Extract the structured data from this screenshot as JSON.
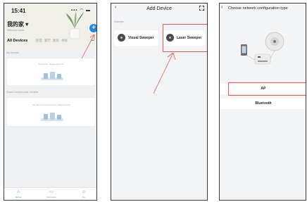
{
  "phone1": {
    "status_time": "15:41",
    "home_title": "我的家 ▾",
    "home_subtitle": "Welcome home",
    "tabs": [
      "All Devices",
      "卧室",
      "客厅",
      "厨房",
      "书房"
    ],
    "more": "•••",
    "my_devices_label": "My Devices",
    "no_devices_text": "No device, please add one",
    "shared_label": "Shared devices that I receive",
    "no_shared_text": "You have not received any shared device",
    "tabbar": [
      {
        "label": "Home",
        "icon": "house-icon"
      },
      {
        "label": "Messages",
        "icon": "message-icon"
      },
      {
        "label": "Me",
        "icon": "profile-icon"
      }
    ]
  },
  "phone2": {
    "title": "Add Device",
    "back": "‹",
    "category": "Sweeper",
    "devices": [
      "Visual Sweeper",
      "Laser Sweeper"
    ]
  },
  "phone3": {
    "back": "‹",
    "title": "Choose network configuration type",
    "options": [
      "AP",
      "Bluetooth"
    ]
  },
  "colors": {
    "accent": "#1e88e5",
    "highlight": "#e05a4d"
  }
}
